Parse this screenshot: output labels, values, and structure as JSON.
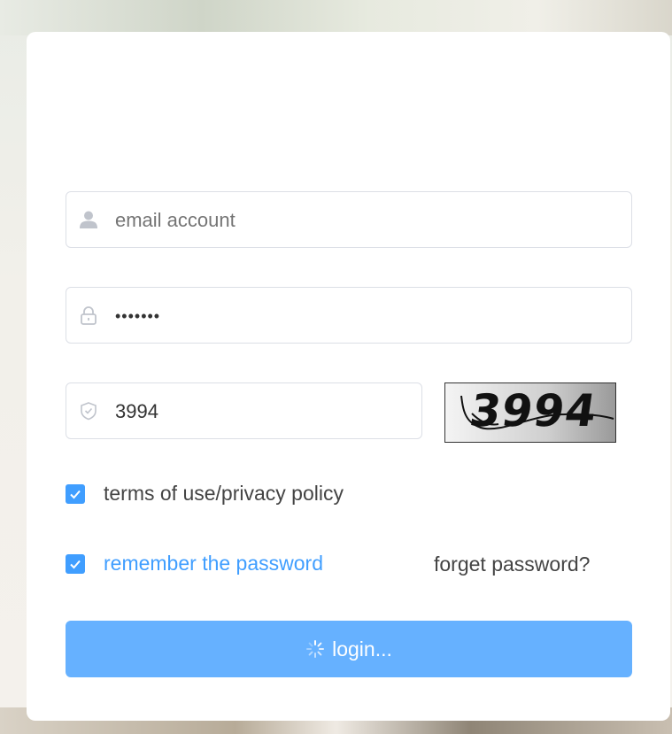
{
  "login_form": {
    "email": {
      "placeholder": "email account",
      "icon": "user-icon"
    },
    "password": {
      "value": "•••••••",
      "icon": "lock-icon"
    },
    "captcha": {
      "value": "3994",
      "icon": "shield-icon",
      "image_text": "3994"
    },
    "terms": {
      "label": "terms of use/privacy policy",
      "checked": true
    },
    "remember": {
      "label": "remember the password",
      "checked": true
    },
    "forget_label": "forget password?",
    "login_label": "login...",
    "login_icon": "loading-spinner-icon"
  },
  "colors": {
    "accent": "#409eff",
    "button_loading": "#66b1ff",
    "border": "#dcdfe6",
    "text": "#606266"
  }
}
